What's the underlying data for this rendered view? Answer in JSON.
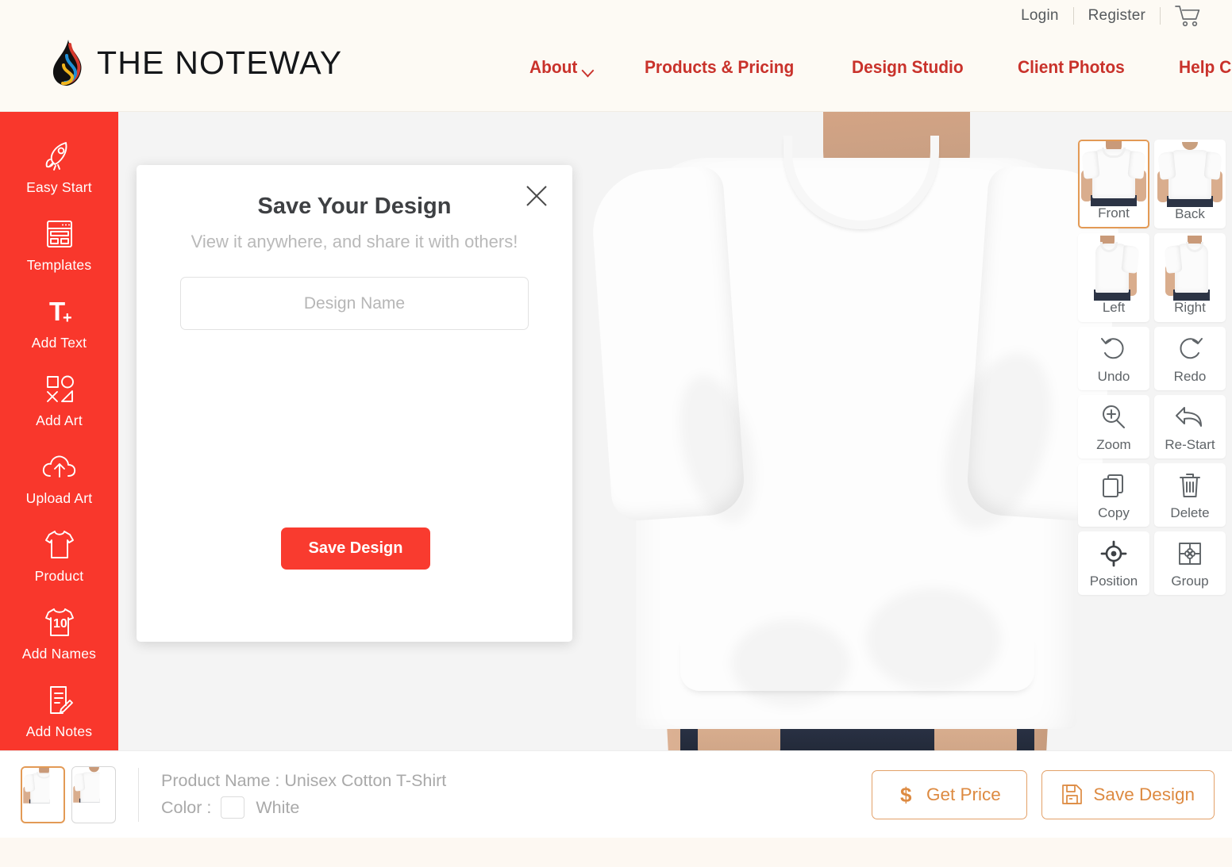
{
  "header": {
    "brand_name": "THE NOTEWAY",
    "logo_icon": "flame-drop-logo",
    "utility": [
      {
        "label": "Login",
        "name": "login-link"
      },
      {
        "label": "Register",
        "name": "register-link"
      }
    ],
    "cart_icon": "shopping-cart-icon",
    "nav": [
      {
        "label": "About",
        "has_chevron": true
      },
      {
        "label": "Products & Pricing",
        "has_chevron": false
      },
      {
        "label": "Design Studio",
        "has_chevron": false
      },
      {
        "label": "Client Photos",
        "has_chevron": false
      },
      {
        "label": "Help Centre",
        "has_chevron": true
      }
    ]
  },
  "sidebar": {
    "background_color": "#F9372C",
    "items": [
      {
        "label": "Easy Start",
        "icon": "rocket-icon"
      },
      {
        "label": "Templates",
        "icon": "layout-template-icon"
      },
      {
        "label": "Add Text",
        "icon": "text-plus-icon"
      },
      {
        "label": "Add Art",
        "icon": "shapes-icon"
      },
      {
        "label": "Upload Art",
        "icon": "cloud-upload-icon"
      },
      {
        "label": "Product",
        "icon": "tshirt-icon"
      },
      {
        "label": "Add Names",
        "icon": "jersey-number-icon",
        "badge": "10"
      },
      {
        "label": "Add Notes",
        "icon": "note-pencil-icon"
      }
    ]
  },
  "modal": {
    "title": "Save Your Design",
    "subtitle": "View it anywhere, and share it with others!",
    "input_placeholder": "Design Name",
    "input_value": "",
    "save_label": "Save Design",
    "close_icon": "close-icon",
    "accent_color": "#F93B2F"
  },
  "toolpanel": {
    "selected": "Front",
    "selected_border_color": "#E39A55",
    "views": [
      {
        "label": "Front",
        "icon": "tshirt-front-thumb",
        "selected": true
      },
      {
        "label": "Back",
        "icon": "tshirt-back-thumb",
        "selected": false
      },
      {
        "label": "Left",
        "icon": "tshirt-left-thumb",
        "selected": false
      },
      {
        "label": "Right",
        "icon": "tshirt-right-thumb",
        "selected": false
      }
    ],
    "actions": [
      {
        "label": "Undo",
        "icon": "undo-icon"
      },
      {
        "label": "Redo",
        "icon": "redo-icon"
      },
      {
        "label": "Zoom",
        "icon": "zoom-in-icon"
      },
      {
        "label": "Re-Start",
        "icon": "restart-arrow-icon"
      },
      {
        "label": "Copy",
        "icon": "copy-icon"
      },
      {
        "label": "Delete",
        "icon": "trash-icon"
      },
      {
        "label": "Position",
        "icon": "crosshair-icon"
      },
      {
        "label": "Group",
        "icon": "puzzle-group-icon"
      }
    ]
  },
  "bottombar": {
    "thumbnails": [
      {
        "name": "product-thumb-front",
        "selected": true
      },
      {
        "name": "product-thumb-back",
        "selected": false
      }
    ],
    "product_label": "Product Name : Unisex Cotton T-Shirt",
    "color_label": "Color :",
    "color_value": "White",
    "color_hex": "#FFFFFF",
    "buttons": [
      {
        "label": "Get Price",
        "icon": "dollar-icon",
        "name": "get-price-button"
      },
      {
        "label": "Save Design",
        "icon": "floppy-disk-icon",
        "name": "save-design-button"
      }
    ],
    "button_color": "#DD8A41"
  },
  "canvas": {
    "background_color": "#F4F4F4",
    "product_preview": "male-model-white-tshirt-front"
  }
}
